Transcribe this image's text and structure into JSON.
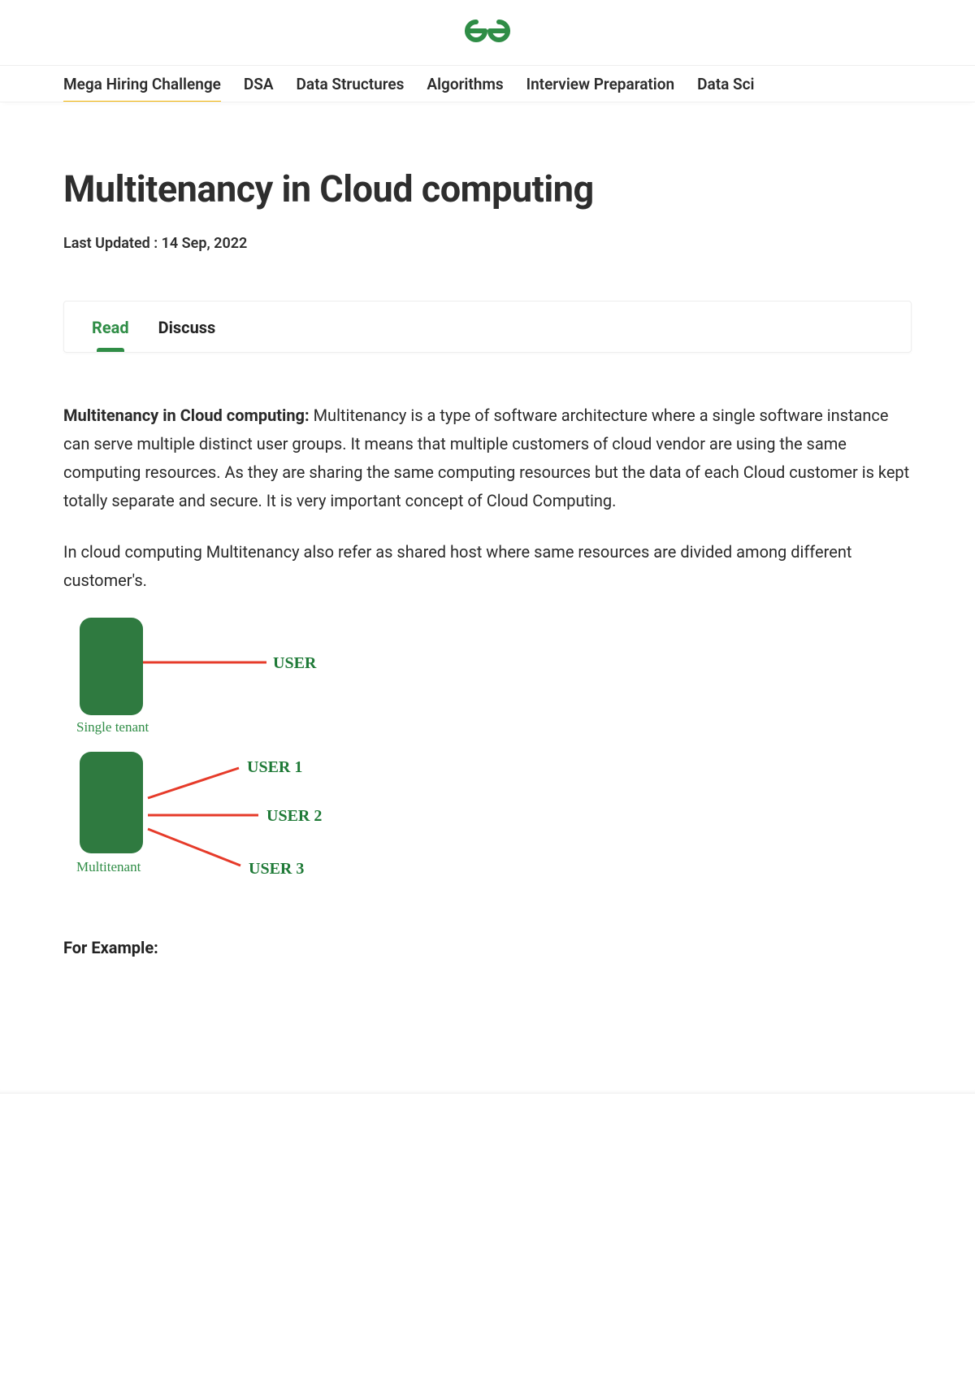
{
  "nav": {
    "items": [
      "Mega Hiring Challenge",
      "DSA",
      "Data Structures",
      "Algorithms",
      "Interview Preparation",
      "Data Sci"
    ],
    "active_index": 0
  },
  "article": {
    "title": "Multitenancy in Cloud computing",
    "last_updated_label": "Last Updated : 14 Sep, 2022",
    "tabs": {
      "read": "Read",
      "discuss": "Discuss"
    },
    "lead_bold": "Multitenancy in Cloud computing: ",
    "lead_rest": "Multitenancy is a type of software architecture where a single software instance can serve multiple distinct user groups. It means that multiple customers of cloud vendor are using the same computing resources. As they are sharing the same computing resources but the data of each Cloud customer is kept totally separate and secure. It is very important concept of Cloud Computing.",
    "para2": "In cloud computing Multitenancy also refer as shared host where same resources are divided among different customer's.",
    "for_example": "For Example:"
  },
  "diagram": {
    "single_label": "Single tenant",
    "multi_label": "Multitenant",
    "user": "USER",
    "user1": "USER 1",
    "user2": "USER 2",
    "user3": "USER 3"
  }
}
